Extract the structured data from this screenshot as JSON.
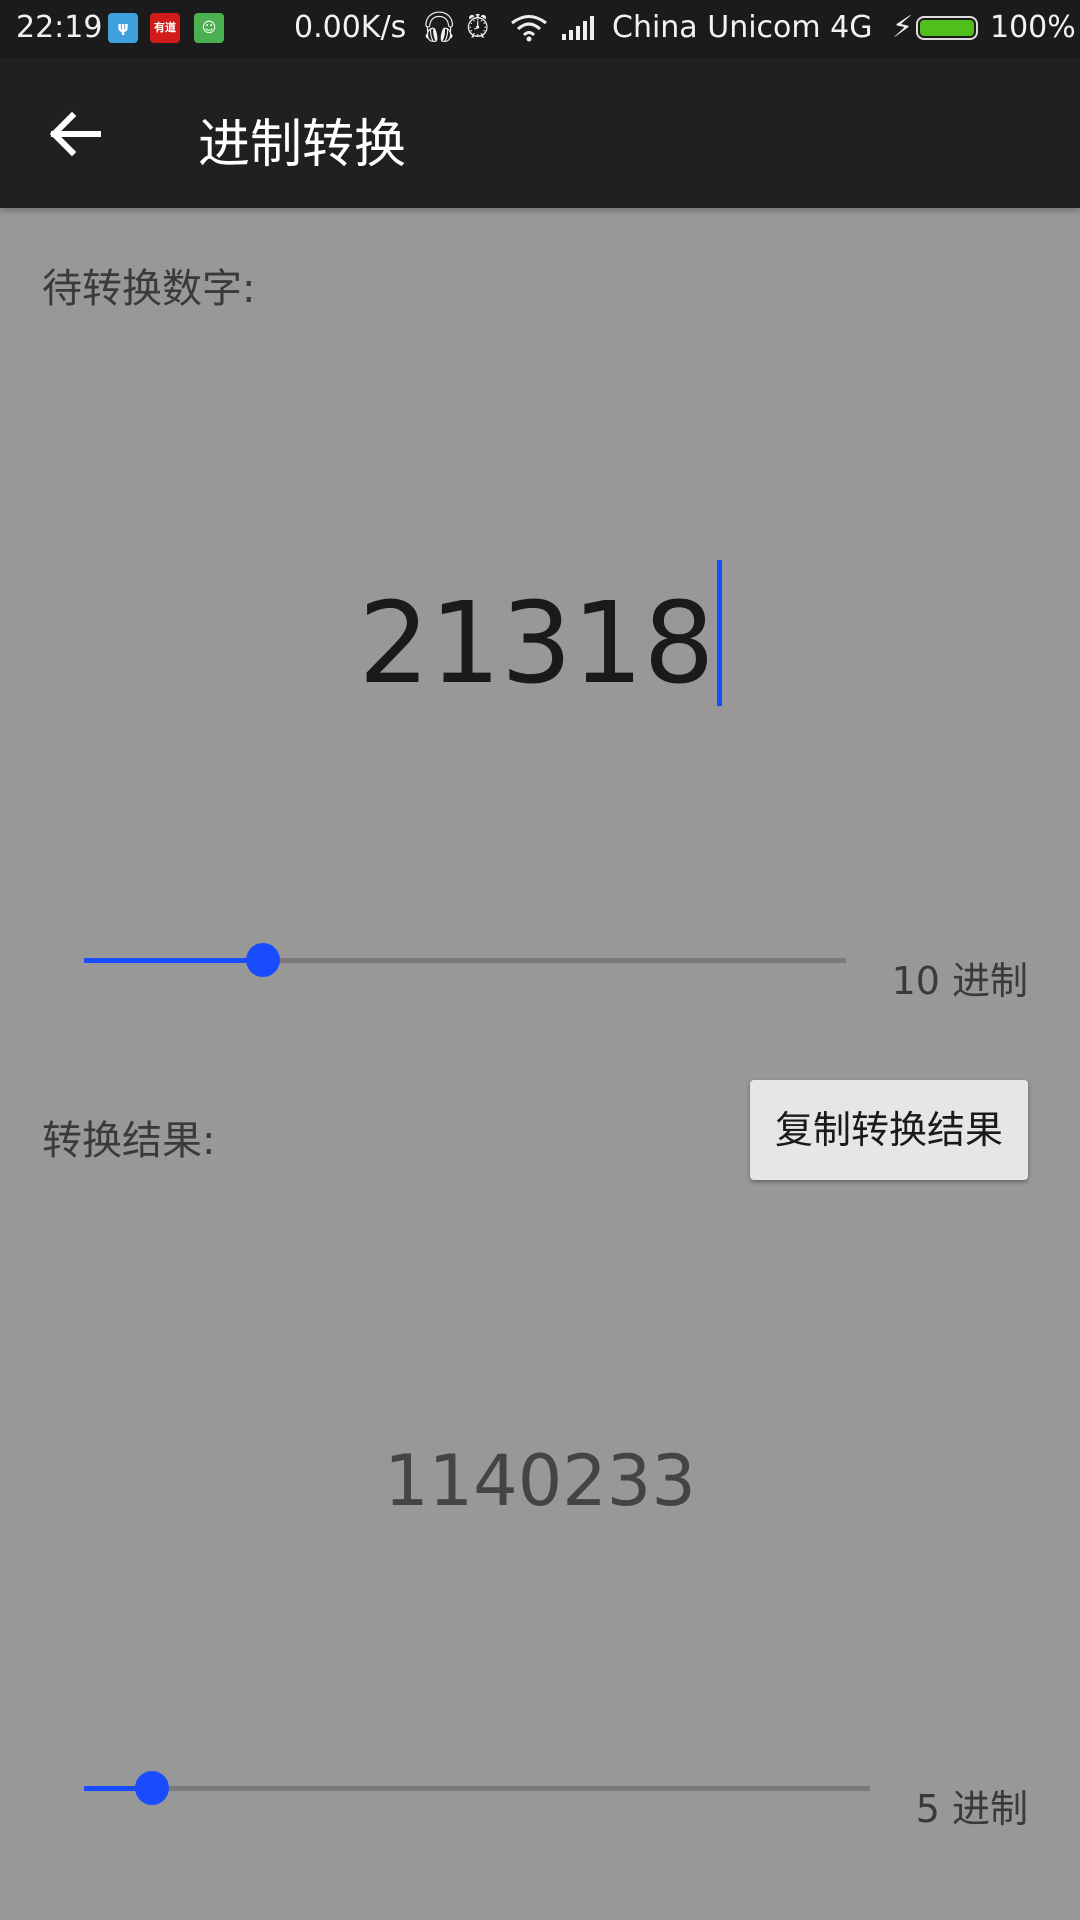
{
  "status_bar": {
    "time": "22:19",
    "notification_icons": [
      {
        "name": "usb-icon",
        "color": "#3ea0dc",
        "glyph": "ψ"
      },
      {
        "name": "youdao-icon",
        "color": "#d11a1a",
        "glyph": "有道"
      },
      {
        "name": "android-icon",
        "color": "#4caf50",
        "glyph": "☺"
      }
    ],
    "net_speed": "0.00K/s",
    "carrier": "China  Unicom  4G",
    "battery_level": 1.0,
    "battery_text": "100%"
  },
  "app_bar": {
    "title": "进制转换",
    "back_icon": "arrow-left-icon"
  },
  "input": {
    "label": "待转换数字:",
    "value": "21318"
  },
  "input_base": {
    "label": "10 进制",
    "slider_fraction": 0.235
  },
  "result": {
    "label": "转换结果:",
    "copy_button_label": "复制转换结果",
    "value": "1140233"
  },
  "result_base": {
    "label": "5 进制",
    "slider_fraction": 0.087
  },
  "colors": {
    "accent": "#1a4cff",
    "background": "#989898",
    "app_bar": "#202020"
  }
}
